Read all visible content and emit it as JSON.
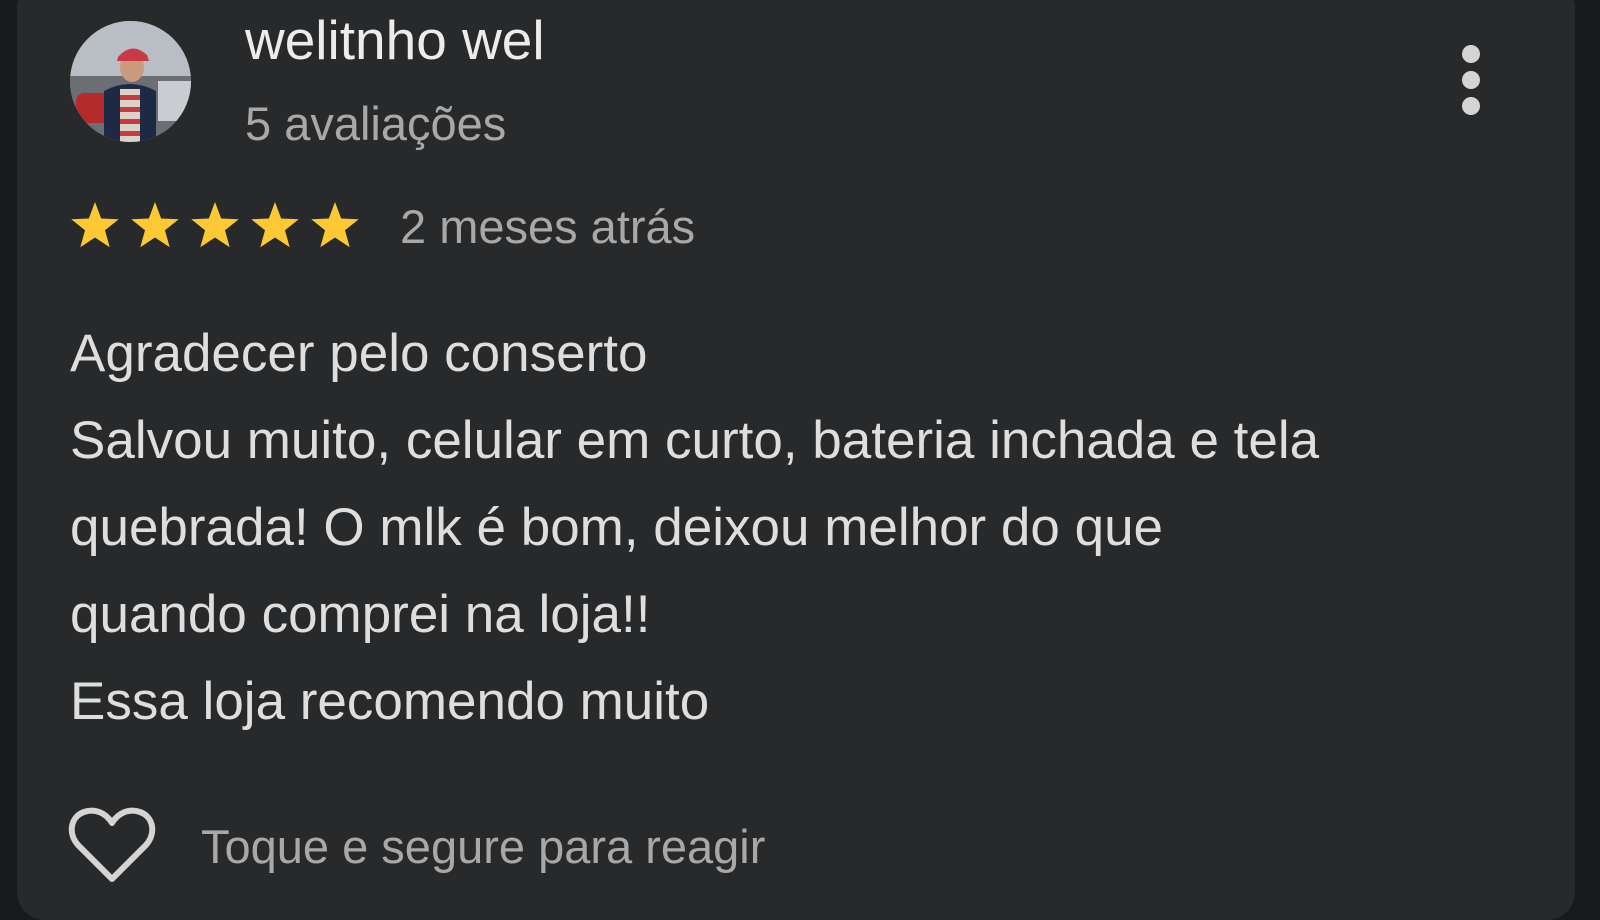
{
  "review": {
    "author": "welitnho wel",
    "review_count": "5 avaliações",
    "rating": 5,
    "rating_max": 5,
    "relative_time": "2 meses atrás",
    "text_lines": [
      "Agradecer pelo conserto",
      "Salvou muito, celular em curto, bateria inchada e tela",
      "quebrada! O mlk é bom, deixou melhor do que",
      "quando comprei na loja!!",
      "Essa loja recomendo muito"
    ],
    "react_label": "Toque e segure para reagir"
  },
  "icons": {
    "more": "more-vertical-icon",
    "star": "star-icon",
    "heart": "heart-outline-icon"
  },
  "colors": {
    "background": "#28292b",
    "star": "#fcc934",
    "primary_text": "#ececec",
    "secondary_text": "#a8a8a8"
  }
}
